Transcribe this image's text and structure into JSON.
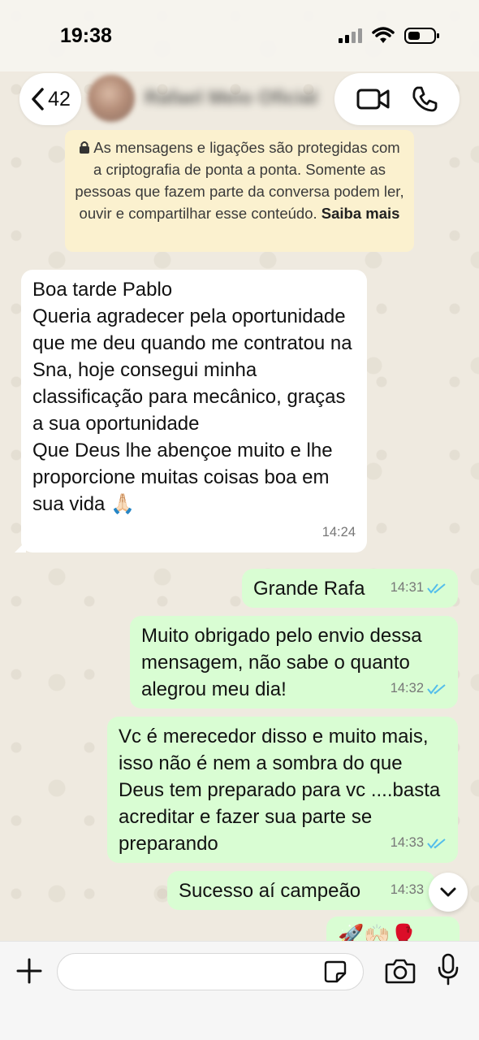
{
  "status_bar": {
    "time": "19:38"
  },
  "header": {
    "back_count": "42",
    "contact_name": "Rafael Meio Oficial"
  },
  "encryption_notice": {
    "text": "As mensagens e ligações são protegidas com a criptografia de ponta a ponta. Somente as pessoas que fazem parte da conversa podem ler, ouvir e compartilhar esse conteúdo.",
    "link": "Saiba mais"
  },
  "messages": [
    {
      "direction": "incoming",
      "text": "Boa tarde Pablo\nQueria agradecer pela oportunidade que me deu quando me contratou na Sna, hoje consegui minha classificação para mecânico, graças a sua oportunidade\nQue Deus lhe abençoe muito e lhe proporcione muitas coisas boa em sua vida 🙏🏻",
      "time": "14:24"
    },
    {
      "direction": "outgoing",
      "text": "Grande Rafa",
      "time": "14:31",
      "status": "read"
    },
    {
      "direction": "outgoing",
      "text": "Muito obrigado pelo envio dessa mensagem, não sabe o quanto alegrou meu dia!",
      "time": "14:32",
      "status": "read"
    },
    {
      "direction": "outgoing",
      "text": "Vc é merecedor disso e muito mais, isso não é nem a sombra do que Deus tem preparado para vc ....basta acreditar e fazer sua parte se preparando",
      "time": "14:33",
      "status": "read"
    },
    {
      "direction": "outgoing",
      "text": "Sucesso aí campeão",
      "time": "14:33"
    },
    {
      "direction": "outgoing",
      "text": "🚀🙌🏻🥊"
    }
  ],
  "input": {
    "placeholder": ""
  },
  "colors": {
    "incoming_bubble": "#ffffff",
    "outgoing_bubble": "#d9fdd3",
    "read_ticks": "#53bdeb",
    "notice_bg": "#fbf1cf"
  },
  "icons": [
    "chevron-left-icon",
    "video-call-icon",
    "phone-icon",
    "lock-icon",
    "double-check-icon",
    "chevron-down-icon",
    "plus-icon",
    "sticker-icon",
    "camera-icon",
    "mic-icon"
  ]
}
